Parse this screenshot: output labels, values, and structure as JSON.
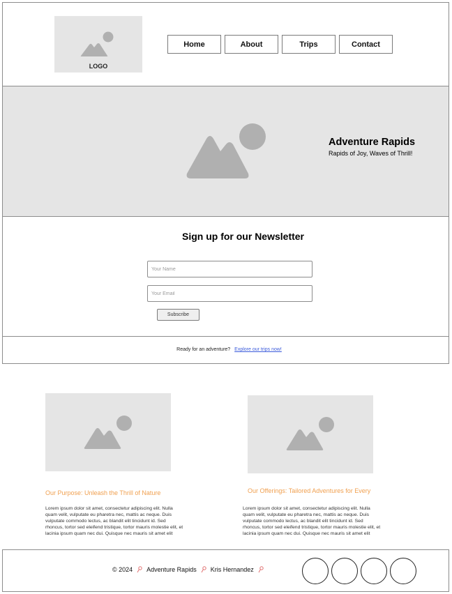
{
  "header": {
    "logo_text": "LOGO",
    "nav": [
      {
        "label": "Home"
      },
      {
        "label": "About"
      },
      {
        "label": "Trips"
      },
      {
        "label": "Contact"
      }
    ]
  },
  "hero": {
    "title": "Adventure Rapids",
    "tagline": "Rapids of Joy, Waves of Thrill!"
  },
  "newsletter": {
    "title": "Sign up for our Newsletter",
    "name_placeholder": "Your Name",
    "email_placeholder": "Your Email",
    "subscribe_label": "Subscribe"
  },
  "cta": {
    "text": "Ready for an adventure?",
    "link_text": "Explore our trips now!"
  },
  "features": [
    {
      "title": "Our Purpose: Unleash the Thrill of Nature",
      "body": "Lorem ipsum dolor sit amet, consectetur adipiscing elit. Nulla quam velit, vulputate eu pharetra nec, mattis ac neque. Duis vulputate commodo lectus, ac blandit elit tincidunt id. Sed rhoncus, tortor sed eleifend tristique, tortor mauris molestie elit, et lacinia ipsum quam nec dui. Quisque nec mauris sit amet elit"
    },
    {
      "title": "Our Offerings: Tailored Adventures for Every",
      "body": "Lorem ipsum dolor sit amet, consectetur adipiscing elit. Nulla quam velit, vulputate eu pharetra nec, mattis ac neque. Duis vulputate commodo lectus, ac blandit elit tincidunt id. Sed rhoncus, tortor sed eleifend tristique, tortor mauris molestie elit, et lacinia ipsum quam nec dui. Quisque nec mauris sit amet elit"
    }
  ],
  "footer": {
    "copyright": "© 2024",
    "brand": "Adventure Rapids",
    "author": "Kris Hernandez",
    "social_icons": [
      "social-icon-1",
      "social-icon-2",
      "social-icon-3",
      "social-icon-4"
    ]
  },
  "colors": {
    "placeholder_gray": "#e5e5e5",
    "image_icon_gray": "#b0b0b0",
    "feature_title": "#f0a050",
    "link": "#3b5bdb"
  }
}
